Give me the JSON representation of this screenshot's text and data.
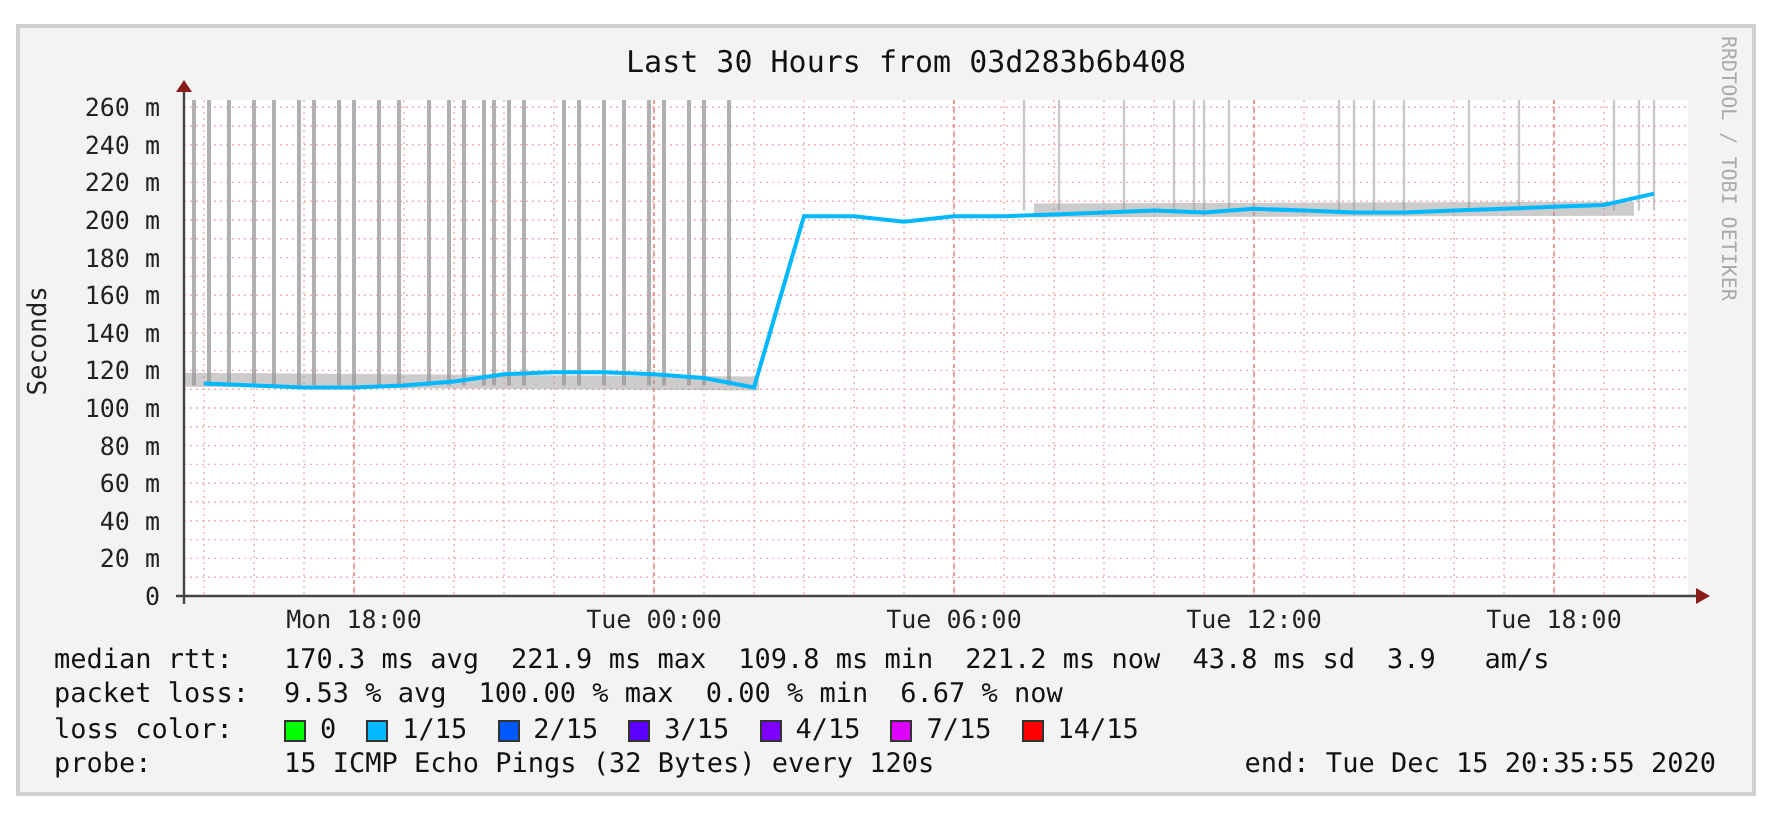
{
  "graph": {
    "title": "Last 30 Hours from 03d283b6b408",
    "side_text": "RRDTOOL / TOBI OETIKER",
    "chart_data": {
      "type": "line",
      "grid": true,
      "ylabel": "Seconds",
      "ylim": [
        0,
        260
      ],
      "yticks": [
        {
          "value": 0,
          "label": "0"
        },
        {
          "value": 20,
          "label": "20 m"
        },
        {
          "value": 40,
          "label": "40 m"
        },
        {
          "value": 60,
          "label": "60 m"
        },
        {
          "value": 80,
          "label": "80 m"
        },
        {
          "value": 100,
          "label": "100 m"
        },
        {
          "value": 120,
          "label": "120 m"
        },
        {
          "value": 140,
          "label": "140 m"
        },
        {
          "value": 160,
          "label": "160 m"
        },
        {
          "value": 180,
          "label": "180 m"
        },
        {
          "value": 200,
          "label": "200 m"
        },
        {
          "value": 220,
          "label": "220 m"
        },
        {
          "value": 240,
          "label": "240 m"
        },
        {
          "value": 260,
          "label": "260 m"
        }
      ],
      "categories": [
        null,
        null,
        null,
        "Mon 18:00",
        null,
        null,
        null,
        null,
        null,
        "Tue 00:00",
        null,
        null,
        null,
        null,
        null,
        "Tue 06:00",
        null,
        null,
        null,
        null,
        null,
        "Tue 12:00",
        null,
        null,
        null,
        null,
        null,
        "Tue 18:00",
        null,
        null
      ],
      "series": [
        {
          "color": "#00b8ff",
          "values": [
            113,
            112,
            111,
            111,
            112,
            114,
            118,
            119,
            119,
            118,
            116,
            111,
            202,
            202,
            199,
            202,
            202,
            203,
            204,
            205,
            204,
            206,
            205,
            204,
            204,
            205,
            206,
            207,
            208,
            214
          ]
        }
      ]
    }
  },
  "legend": [
    {
      "kind": "text",
      "label": "median rtt:",
      "items": [
        "170.3 ms avg",
        "221.9 ms max",
        "109.8 ms min",
        "221.2 ms now",
        "43.8 ms sd",
        "3.9   am/s"
      ]
    },
    {
      "kind": "text",
      "label": "packet loss:",
      "items": [
        "9.53 % avg",
        "100.00 % max",
        "0.00 % min",
        "6.67 % now"
      ]
    },
    {
      "kind": "colors",
      "label": "loss color:",
      "swatches": [
        {
          "label": "0",
          "color": "#00ff00"
        },
        {
          "label": "1/15",
          "color": "#00b8ff"
        },
        {
          "label": "2/15",
          "color": "#0059ff"
        },
        {
          "label": "3/15",
          "color": "#5e00ff"
        },
        {
          "label": "4/15",
          "color": "#7e00ff"
        },
        {
          "label": "7/15",
          "color": "#dd00ff"
        },
        {
          "label": "14/15",
          "color": "#ff0000"
        }
      ]
    },
    {
      "kind": "probe",
      "label": "probe:",
      "items": [
        "15 ICMP Echo Pings (32 Bytes) every 120s"
      ],
      "end": "end: Tue Dec 15 20:35:55 2020"
    }
  ]
}
